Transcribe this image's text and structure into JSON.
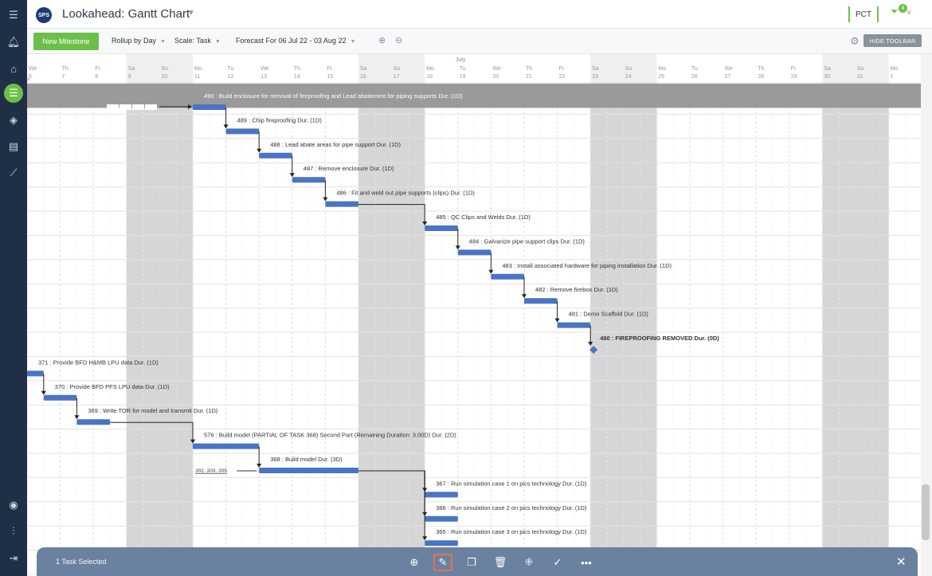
{
  "app": {
    "logo": "SPS",
    "title": "Lookahead: Gantt Chart",
    "pct_label": "PCT",
    "filter_badge": "4"
  },
  "sidebar": {
    "icons": [
      "menu-icon",
      "bell-icon",
      "home-icon",
      "schedule-icon",
      "layers-icon",
      "reports-icon",
      "analytics-icon",
      "user-icon",
      "sliders-icon",
      "logout-icon"
    ],
    "active_icon": "schedule-icon"
  },
  "toolbar": {
    "new_milestone": "New Milestone",
    "rollup": "Rollup by Day",
    "scale": "Scale: Task",
    "forecast": "Forecast For 06 Jul 22 - 03 Aug 22",
    "hide_toolbar": "HIDE TOOLBAR"
  },
  "timeline": {
    "month": "July",
    "days": [
      {
        "dow": "We",
        "d": "6"
      },
      {
        "dow": "Th",
        "d": "7"
      },
      {
        "dow": "Fr",
        "d": "8"
      },
      {
        "dow": "Sa",
        "d": "9"
      },
      {
        "dow": "Su",
        "d": "10"
      },
      {
        "dow": "Mo",
        "d": "11"
      },
      {
        "dow": "Tu",
        "d": "12"
      },
      {
        "dow": "We",
        "d": "13"
      },
      {
        "dow": "Th",
        "d": "14"
      },
      {
        "dow": "Fr",
        "d": "15"
      },
      {
        "dow": "Sa",
        "d": "16"
      },
      {
        "dow": "Su",
        "d": "17"
      },
      {
        "dow": "Mo",
        "d": "18"
      },
      {
        "dow": "Tu",
        "d": "19"
      },
      {
        "dow": "We",
        "d": "20"
      },
      {
        "dow": "Th",
        "d": "21"
      },
      {
        "dow": "Fr",
        "d": "22"
      },
      {
        "dow": "Sa",
        "d": "23"
      },
      {
        "dow": "Su",
        "d": "24"
      },
      {
        "dow": "Mo",
        "d": "25"
      },
      {
        "dow": "Tu",
        "d": "26"
      },
      {
        "dow": "We",
        "d": "27"
      },
      {
        "dow": "Th",
        "d": "28"
      },
      {
        "dow": "Fr",
        "d": "29"
      },
      {
        "dow": "Sa",
        "d": "30"
      },
      {
        "dow": "Su",
        "d": "31"
      },
      {
        "dow": "Mo",
        "d": "1"
      }
    ]
  },
  "tasks": [
    {
      "id": "490",
      "label": "490 : Build enclosure for removal of fireproofing and Lead abatement for piping supports Dur. (1D)",
      "start": "11",
      "dur": 1,
      "highlight": true
    },
    {
      "id": "489",
      "label": "489 : Chip fireproofing Dur. (1D)",
      "start": "12",
      "dur": 1
    },
    {
      "id": "488",
      "label": "488 : Lead abate areas for pipe support Dur. (1D)",
      "start": "13",
      "dur": 1
    },
    {
      "id": "487",
      "label": "487 : Remove enclosure Dur. (1D)",
      "start": "14",
      "dur": 1
    },
    {
      "id": "486",
      "label": "486 : Fit and weld out pipe supports (clips) Dur. (1D)",
      "start": "15",
      "dur": 1
    },
    {
      "id": "485",
      "label": "485 : QC Clips and Welds Dur. (1D)",
      "start": "18",
      "dur": 1
    },
    {
      "id": "484",
      "label": "484 : Galvanize pipe support clips Dur. (1D)",
      "start": "19",
      "dur": 1
    },
    {
      "id": "483",
      "label": "483 : Install associated hardware for piping installation Dur. (1D)",
      "start": "20",
      "dur": 1
    },
    {
      "id": "482",
      "label": "482 : Remove firebox Dur. (1D)",
      "start": "21",
      "dur": 1
    },
    {
      "id": "481",
      "label": "481 : Demo Scaffold Dur. (1D)",
      "start": "22",
      "dur": 1
    },
    {
      "id": "480",
      "label": "480 : FIREPROOFING REMOVED Dur. (0D)",
      "start": "23",
      "dur": 0,
      "milestone": true
    },
    {
      "id": "371",
      "label": "371 : Provide BFD H&MB LPU data Dur. (1D)",
      "start": "6",
      "dur": 0.5
    },
    {
      "id": "370",
      "label": "370 : Provide BFD PFS LPU data Dur. (1D)",
      "start": "6.5",
      "dur": 1
    },
    {
      "id": "369",
      "label": "369 : Write TOR for model and transmit Dur. (1D)",
      "start": "7.5",
      "dur": 1
    },
    {
      "id": "576",
      "label": "576 : Build model (PARTIAL OF TASK 368) Second Part (Remaining Duration: 3.00D) Dur. (2D)",
      "start": "11",
      "dur": 2
    },
    {
      "id": "368",
      "label": "368 : Build model Dur. (3D)",
      "start": "13",
      "dur": 3,
      "pred_label": "202, 203, 205"
    },
    {
      "id": "367",
      "label": "367 : Run simulation case 1 on pics technology Dur. (1D)",
      "start": "18",
      "dur": 1
    },
    {
      "id": "366",
      "label": "366 : Run simulation case 2 on pics technology Dur. (1D)",
      "start": "18",
      "dur": 1
    },
    {
      "id": "365",
      "label": "365 : Run simulation case 3 on pics technology Dur. (1D)",
      "start": "18",
      "dur": 1
    }
  ],
  "actionbar": {
    "selected": "1 Task Selected",
    "buttons": [
      "add-icon",
      "edit-icon",
      "copy-icon",
      "delete-icon",
      "link-icon",
      "complete-icon",
      "more-icon"
    ],
    "selected_button": "edit-icon"
  },
  "colors": {
    "bar": "#4a74c4",
    "weekend": "#d6d6d6",
    "highlight": "#9a9a9a",
    "accent": "#6cc04a",
    "sidebar": "#1f3046",
    "actionbar": "#6a82a0"
  }
}
